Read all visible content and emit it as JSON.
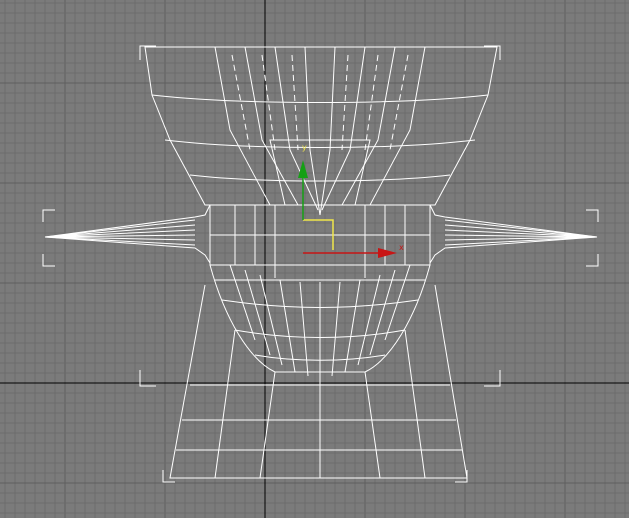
{
  "viewport": {
    "background_color": "#7b7b7b",
    "grid_color": "#6c6c6c",
    "grid_major_color": "#5f5f5f",
    "home_grid_axis_color": "#000000",
    "wireframe_color": "#ffffff",
    "selection_bracket_color": "#ffffff"
  },
  "gizmo": {
    "x_label": "x",
    "y_label": "y",
    "x_color": "#c81414",
    "y_color": "#14a014",
    "plane_color": "#f0e64a"
  },
  "icons": {
    "transform_gizmo": "move-gizmo-icon"
  }
}
